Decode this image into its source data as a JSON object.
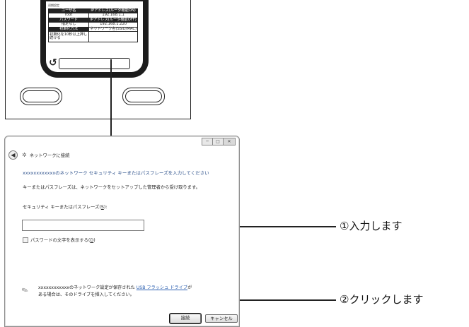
{
  "device": {
    "label_title": "初期設定",
    "rows": [
      {
        "left": "ユーザ名",
        "right": "IPアドレス(ルータ機能ON)",
        "left_dark": true,
        "right_dark": true
      },
      {
        "left": "root",
        "right": "192.168.1.1",
        "left_dark": false,
        "right_dark": false
      },
      {
        "left": "パスワード",
        "right": "IPアドレス(ルータ機能OFF)",
        "left_dark": true,
        "right_dark": true
      },
      {
        "left": "指定なし",
        "right": "192.168.1.220",
        "left_dark": false,
        "right_dark": false
      },
      {
        "left": "初期化方法",
        "right": "ネットワーク名(SSID/MAC)",
        "left_dark": true,
        "right_dark": false
      },
      {
        "left": "初期化を10秒以上押し続ける",
        "right": "",
        "left_dark": false,
        "right_dark": false
      }
    ],
    "reset_icon": "reset-icon"
  },
  "dialog": {
    "title": "ネットワークに接続",
    "heading": "xxxxxxxxxxxxのネットワーク セキュリティ キーまたはパスフレーズを入力してください",
    "description": "キーまたはパスフレーズは、ネットワークをセットアップした管理者から受け取ります。",
    "key_label_prefix": "セキュリティ キーまたはパスフレーズ(",
    "key_label_access": "S",
    "key_label_suffix": "):",
    "key_value": "",
    "show_chars_prefix": "パスワードの文字を表示する(",
    "show_chars_access": "D",
    "show_chars_suffix": ")",
    "show_chars_checked": false,
    "usb_line1_before": "xxxxxxxxxxxxのネットワーク設定が保存された ",
    "usb_link": "USB フラッシュ ドライブ",
    "usb_line1_after": "が",
    "usb_line2": "ある場合は、そのドライブを挿入してください。",
    "connect_label": "接続",
    "cancel_label": "キャンセル"
  },
  "callouts": {
    "step1": "①入力します",
    "step2": "②クリックします"
  }
}
